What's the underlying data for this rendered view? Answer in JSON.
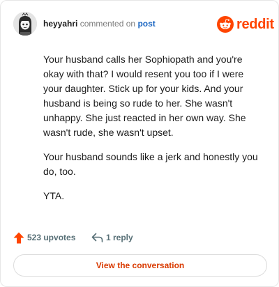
{
  "header": {
    "username": "heyyahri",
    "action_text": "commented on",
    "post_link": "post",
    "brand": "reddit"
  },
  "comment": {
    "paragraphs": [
      "Your husband calls her Sophiopath and you're okay with that? I would resent you too if I were your daughter. Stick up for your kids. And your husband is being so rude to her. She wasn't unhappy. She just reacted in her own way. She wasn't rude, she wasn't upset.",
      "Your husband sounds like a jerk and honestly you do, too.",
      "YTA."
    ]
  },
  "footer": {
    "upvotes_label": "523 upvotes",
    "replies_label": "1 reply",
    "cta_label": "View the conversation"
  },
  "colors": {
    "brand_orange": "#ff4500",
    "upvote_orange": "#ff4500",
    "link_blue": "#1a66c2",
    "cta_text": "#d93a00",
    "muted": "#576f76"
  },
  "icons": {
    "upvote": "upvote-arrow-icon",
    "reply": "reply-arrow-icon",
    "brand_logo": "reddit-snoo-icon"
  }
}
